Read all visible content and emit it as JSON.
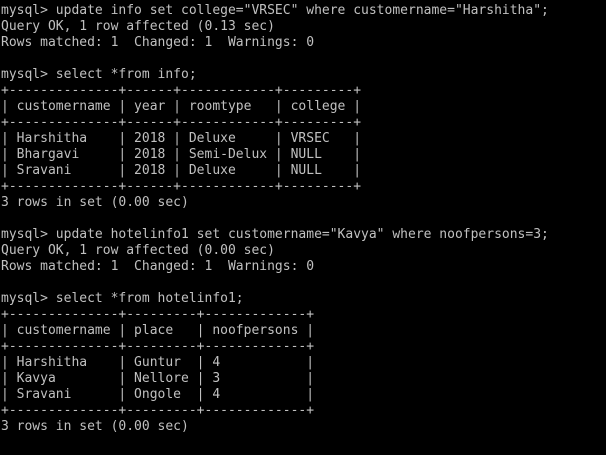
{
  "terminal": {
    "lines": [
      "mysql> update info set college=\"VRSEC\" where customername=\"Harshitha\";",
      "Query OK, 1 row affected (0.13 sec)",
      "Rows matched: 1  Changed: 1  Warnings: 0",
      "",
      "mysql> select *from info;",
      "+--------------+------+------------+---------+",
      "| customername | year | roomtype   | college |",
      "+--------------+------+------------+---------+",
      "| Harshitha    | 2018 | Deluxe     | VRSEC   |",
      "| Bhargavi     | 2018 | Semi-Delux | NULL    |",
      "| Sravani      | 2018 | Deluxe     | NULL    |",
      "+--------------+------+------------+---------+",
      "3 rows in set (0.00 sec)",
      "",
      "mysql> update hotelinfo1 set customername=\"Kavya\" where noofpersons=3;",
      "Query OK, 1 row affected (0.00 sec)",
      "Rows matched: 1  Changed: 1  Warnings: 0",
      "",
      "mysql> select *from hotelinfo1;",
      "+--------------+---------+-------------+",
      "| customername | place   | noofpersons |",
      "+--------------+---------+-------------+",
      "| Harshitha    | Guntur  | 4           |",
      "| Kavya        | Nellore | 3           |",
      "| Sravani      | Ongole  | 4           |",
      "+--------------+---------+-------------+",
      "3 rows in set (0.00 sec)"
    ]
  },
  "colors": {
    "background": "#000000",
    "foreground": "#c0c0c0"
  }
}
